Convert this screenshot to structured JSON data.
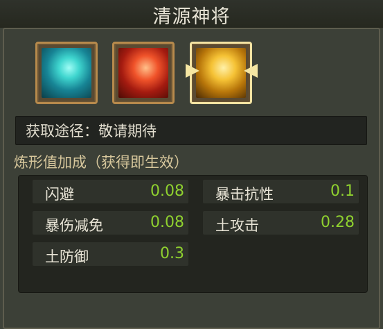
{
  "header": {
    "title": "清源神将"
  },
  "skins": [
    {
      "name": "skin-cyan",
      "colors": [
        "#0f6e88",
        "#56e8dc",
        "#1c4e55"
      ]
    },
    {
      "name": "skin-red",
      "colors": [
        "#6a130b",
        "#f3612a",
        "#9b1c10"
      ]
    },
    {
      "name": "skin-gold",
      "colors": [
        "#6b3d05",
        "#f5c235",
        "#b8760a"
      ],
      "selected": true
    }
  ],
  "source": {
    "label": "获取途径：敬请期待"
  },
  "bonus": {
    "heading": "炼形值加成（获得即生效）",
    "stats": [
      {
        "label": "闪避",
        "value": "0.08"
      },
      {
        "label": "暴击抗性",
        "value": "0.1"
      },
      {
        "label": "暴伤减免",
        "value": "0.08"
      },
      {
        "label": "土攻击",
        "value": "0.28"
      },
      {
        "label": "土防御",
        "value": "0.3"
      }
    ]
  },
  "colors": {
    "value_green": "#8fd12f",
    "frame_gold": "#b78a4c",
    "selected_frame": "#f4e3a2"
  }
}
